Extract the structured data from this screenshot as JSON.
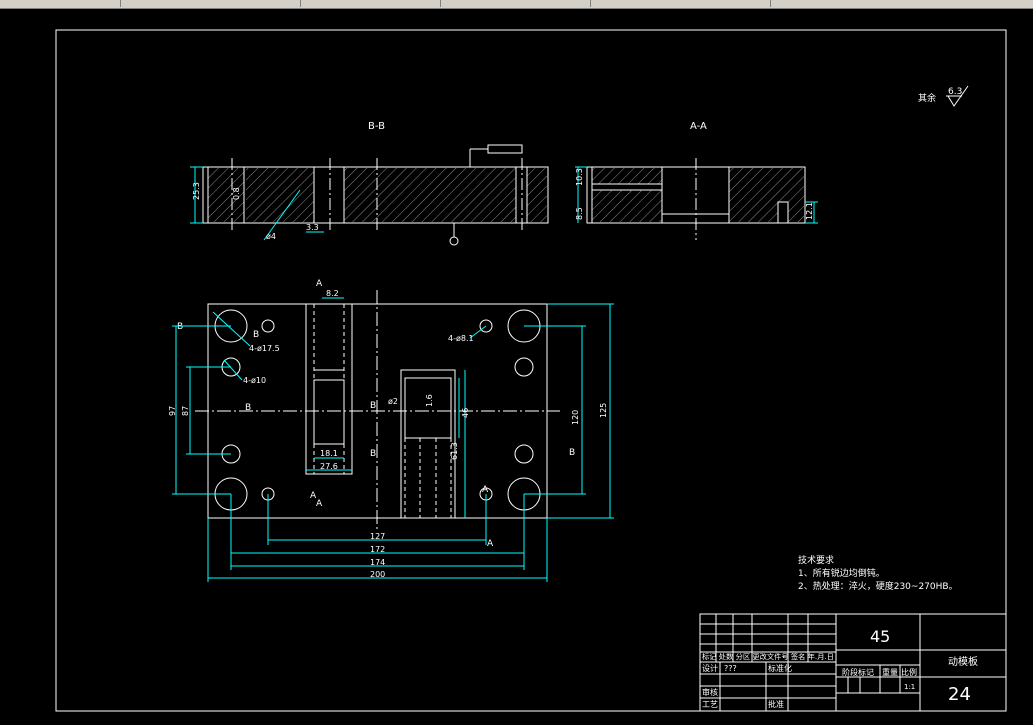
{
  "colors": {
    "background": "#000000",
    "outline": "#ffffff",
    "dimension": "#00ffff",
    "hatch": "#9a9a9a",
    "label": "#ffffff"
  },
  "views": {
    "section_b": "B-B",
    "section_a": "A-A"
  },
  "roughness": {
    "rest_label": "其余",
    "value": "6.3"
  },
  "section_b_dims": {
    "height": "25.3",
    "roughness": "0.8",
    "hole": "ø4",
    "step": "3.3"
  },
  "section_a_dims": {
    "upper": "10.3",
    "lower": "8.5",
    "right": "12.1"
  },
  "plan_labels": {
    "b1": "B",
    "b2": "B",
    "b3": "B",
    "b4": "B",
    "b5": "B",
    "b6": "B",
    "a1": "A",
    "a2": "A",
    "a3": "A",
    "a4": "A",
    "a5": "A"
  },
  "plan_dims": {
    "holes_big": "4-ø17.5",
    "holes_mid": "4-ø10",
    "holes_small": "4-ø8.1",
    "slot_top": "8.2",
    "slot_w1": "18.1",
    "slot_w2": "27.6",
    "phi2": "ø2",
    "pocket_r": "1.6",
    "pocket_h": "61.3",
    "pocket_v": "46",
    "left_97": "97",
    "left_87": "87",
    "right_120": "120",
    "right_125": "125",
    "bottom_127": "127",
    "bottom_172": "172",
    "bottom_174": "174",
    "bottom_200": "200"
  },
  "notes": {
    "title": "技术要求",
    "line1": "1、所有锐边均倒钝。",
    "line2": "2、热处理：淬火，硬度230~270HB。"
  },
  "title_block": {
    "material": "45",
    "part_name": "动模板",
    "drawing_no": "24",
    "revision_header": "标记 处数 分区 更改文件号 签名 年.月.日",
    "design": "设计",
    "designer": "???",
    "standardize": "标准化",
    "stage_mark": "阶段标记",
    "weight": "重量",
    "scale_label": "比例",
    "scale_value": "1:1",
    "review": "审核",
    "process": "工艺",
    "approve": "批准"
  }
}
